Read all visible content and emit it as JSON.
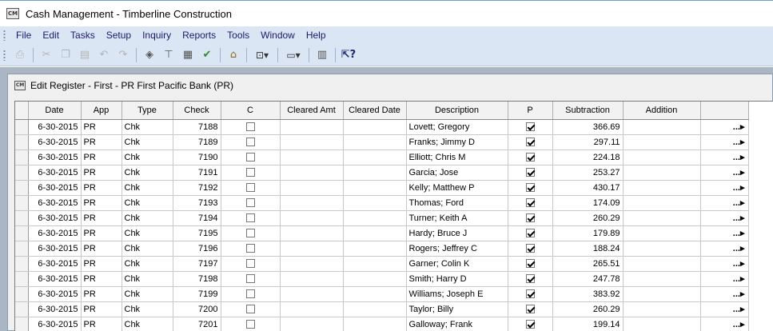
{
  "window": {
    "title": "Cash Management - Timberline Construction",
    "icon_text": "CM"
  },
  "menu": [
    "File",
    "Edit",
    "Tasks",
    "Setup",
    "Inquiry",
    "Reports",
    "Tools",
    "Window",
    "Help"
  ],
  "toolbar": {
    "icons": [
      "printer-icon",
      "cut-icon",
      "copy-icon",
      "paste-icon",
      "undo-icon",
      "redo-icon",
      "eraser-icon",
      "register-icon",
      "notepad-icon",
      "checkmark-icon",
      "home-icon",
      "zoom-icon",
      "page-icon",
      "calculator-icon",
      "help-icon"
    ]
  },
  "child_window": {
    "title": "Edit Register - First - PR  First Pacific Bank (PR)",
    "icon_text": "CM"
  },
  "grid": {
    "columns": [
      "Date",
      "App",
      "Type",
      "Check",
      "C",
      "Cleared Amt",
      "Cleared Date",
      "Description",
      "P",
      "Subtraction",
      "Addition",
      ""
    ],
    "more_glyph": "...▸",
    "rows": [
      {
        "date": "6-30-2015",
        "app": "PR",
        "type": "Chk",
        "check": "7188",
        "c": false,
        "cleared_amt": "",
        "cleared_date": "",
        "description": "Lovett; Gregory",
        "p": true,
        "subtraction": "366.69",
        "addition": ""
      },
      {
        "date": "6-30-2015",
        "app": "PR",
        "type": "Chk",
        "check": "7189",
        "c": false,
        "cleared_amt": "",
        "cleared_date": "",
        "description": "Franks; Jimmy D",
        "p": true,
        "subtraction": "297.11",
        "addition": ""
      },
      {
        "date": "6-30-2015",
        "app": "PR",
        "type": "Chk",
        "check": "7190",
        "c": false,
        "cleared_amt": "",
        "cleared_date": "",
        "description": "Elliott; Chris M",
        "p": true,
        "subtraction": "224.18",
        "addition": ""
      },
      {
        "date": "6-30-2015",
        "app": "PR",
        "type": "Chk",
        "check": "7191",
        "c": false,
        "cleared_amt": "",
        "cleared_date": "",
        "description": "Garcia; Jose",
        "p": true,
        "subtraction": "253.27",
        "addition": ""
      },
      {
        "date": "6-30-2015",
        "app": "PR",
        "type": "Chk",
        "check": "7192",
        "c": false,
        "cleared_amt": "",
        "cleared_date": "",
        "description": "Kelly; Matthew P",
        "p": true,
        "subtraction": "430.17",
        "addition": ""
      },
      {
        "date": "6-30-2015",
        "app": "PR",
        "type": "Chk",
        "check": "7193",
        "c": false,
        "cleared_amt": "",
        "cleared_date": "",
        "description": "Thomas; Ford",
        "p": true,
        "subtraction": "174.09",
        "addition": ""
      },
      {
        "date": "6-30-2015",
        "app": "PR",
        "type": "Chk",
        "check": "7194",
        "c": false,
        "cleared_amt": "",
        "cleared_date": "",
        "description": "Turner; Keith A",
        "p": true,
        "subtraction": "260.29",
        "addition": ""
      },
      {
        "date": "6-30-2015",
        "app": "PR",
        "type": "Chk",
        "check": "7195",
        "c": false,
        "cleared_amt": "",
        "cleared_date": "",
        "description": "Hardy; Bruce J",
        "p": true,
        "subtraction": "179.89",
        "addition": ""
      },
      {
        "date": "6-30-2015",
        "app": "PR",
        "type": "Chk",
        "check": "7196",
        "c": false,
        "cleared_amt": "",
        "cleared_date": "",
        "description": "Rogers; Jeffrey C",
        "p": true,
        "subtraction": "188.24",
        "addition": ""
      },
      {
        "date": "6-30-2015",
        "app": "PR",
        "type": "Chk",
        "check": "7197",
        "c": false,
        "cleared_amt": "",
        "cleared_date": "",
        "description": "Garner; Colin K",
        "p": true,
        "subtraction": "265.51",
        "addition": ""
      },
      {
        "date": "6-30-2015",
        "app": "PR",
        "type": "Chk",
        "check": "7198",
        "c": false,
        "cleared_amt": "",
        "cleared_date": "",
        "description": "Smith; Harry D",
        "p": true,
        "subtraction": "247.78",
        "addition": ""
      },
      {
        "date": "6-30-2015",
        "app": "PR",
        "type": "Chk",
        "check": "7199",
        "c": false,
        "cleared_amt": "",
        "cleared_date": "",
        "description": "Williams; Joseph E",
        "p": true,
        "subtraction": "383.92",
        "addition": ""
      },
      {
        "date": "6-30-2015",
        "app": "PR",
        "type": "Chk",
        "check": "7200",
        "c": false,
        "cleared_amt": "",
        "cleared_date": "",
        "description": "Taylor; Billy",
        "p": true,
        "subtraction": "260.29",
        "addition": ""
      },
      {
        "date": "6-30-2015",
        "app": "PR",
        "type": "Chk",
        "check": "7201",
        "c": false,
        "cleared_amt": "",
        "cleared_date": "",
        "description": "Galloway; Frank",
        "p": true,
        "subtraction": "199.14",
        "addition": ""
      }
    ]
  }
}
